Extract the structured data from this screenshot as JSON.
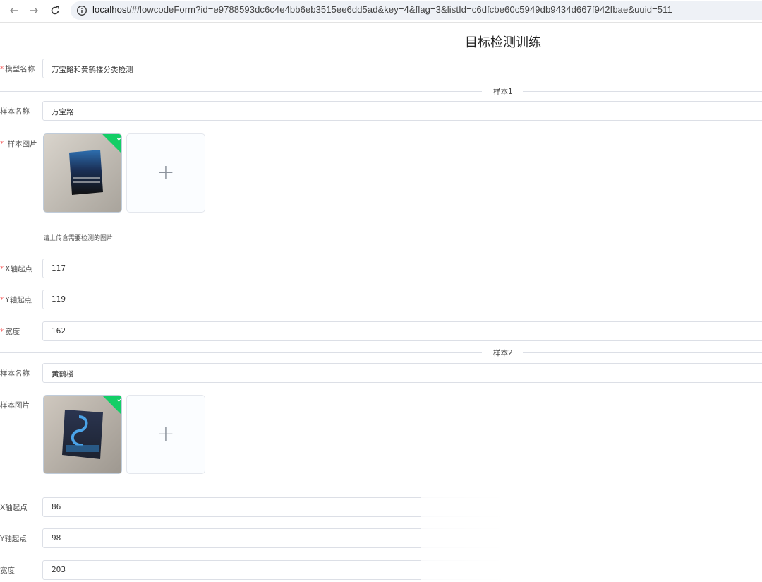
{
  "browser": {
    "url_host": "localhost",
    "url_rest": "/#/lowcodeForm?id=e9788593dc6c4e4bb6eb3515ee6dd5ad&key=4&flag=3&listId=c6dfcbe60c5949db9434d667f942fbae&uuid=511"
  },
  "page": {
    "title": "目标检测训练"
  },
  "model": {
    "label": "模型名称",
    "value": "万宝路和黄鹤楼分类检测"
  },
  "samples": [
    {
      "divider": "样本1",
      "name_label": "样本名称",
      "name_value": "万宝路",
      "image_label": "样本图片",
      "hint": "请上传含需要检测的图片",
      "x_label": "X轴起点",
      "x_value": "117",
      "y_label": "Y轴起点",
      "y_value": "119",
      "w_label": "宽度",
      "w_value": "162"
    },
    {
      "divider": "样本2",
      "name_label": "样本名称",
      "name_value": "黄鹤楼",
      "image_label": "样本图片",
      "x_label": "X轴起点",
      "x_value": "86",
      "y_label": "Y轴起点",
      "y_value": "98",
      "w_label": "宽度",
      "w_value": "203"
    }
  ],
  "upload": {
    "plus": "+"
  },
  "colors": {
    "required": "#f56c6c",
    "success_badge": "#13ce66",
    "border": "#dcdfe6"
  },
  "icons": [
    "back-arrow-icon",
    "forward-arrow-icon",
    "reload-icon",
    "info-icon",
    "check-icon",
    "plus-icon"
  ]
}
